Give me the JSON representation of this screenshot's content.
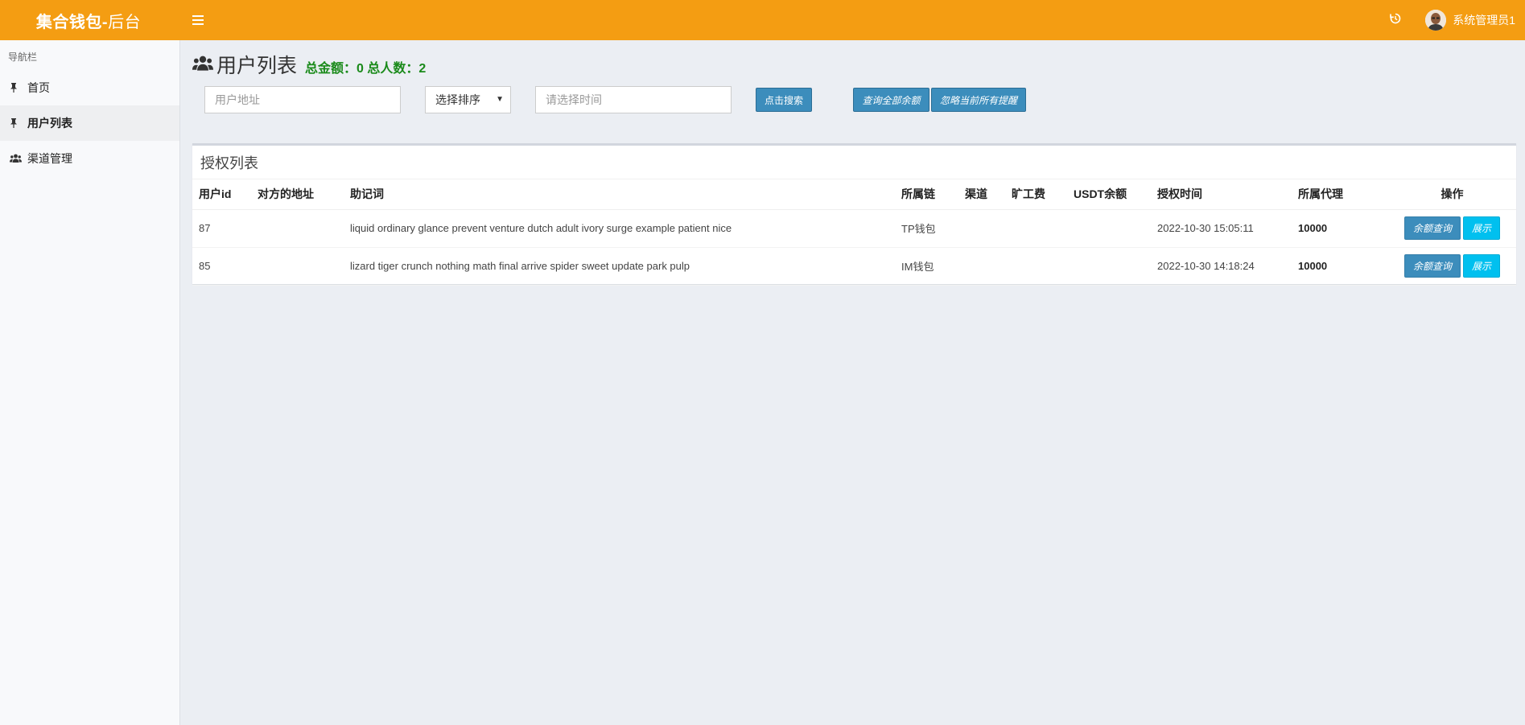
{
  "header": {
    "brand_main": "集合钱包-",
    "brand_suffix": "后台",
    "username": "系统管理员1"
  },
  "sidebar": {
    "caption": "导航栏",
    "items": [
      {
        "label": "首页",
        "icon": "pin-icon"
      },
      {
        "label": "用户列表",
        "icon": "pin-icon",
        "active": true
      },
      {
        "label": "渠道管理",
        "icon": "users-icon"
      }
    ]
  },
  "page": {
    "title": "用户列表",
    "stats": "总金额：0 总人数：2"
  },
  "filters": {
    "address_placeholder": "用户地址",
    "sort_selected": "选择排序",
    "time_placeholder": "请选择时间",
    "search_label": "点击搜索",
    "query_all_label": "查询全部余额",
    "ignore_label": "忽略当前所有提醒"
  },
  "panel": {
    "title": "授权列表",
    "columns": [
      "用户id",
      "对方的地址",
      "助记词",
      "所属链",
      "渠道",
      "旷工费",
      "USDT余额",
      "授权时间",
      "所属代理",
      "操作"
    ],
    "rows": [
      {
        "id": "87",
        "address": "",
        "mnemonic": "liquid ordinary glance prevent venture dutch adult ivory surge example patient nice",
        "chain": "TP钱包",
        "channel": "",
        "fee": "",
        "usdt": "",
        "time": "2022-10-30 15:05:11",
        "agent": "10000",
        "query_label": "余额查询",
        "show_label": "展示"
      },
      {
        "id": "85",
        "address": "",
        "mnemonic": "lizard tiger crunch nothing math final arrive spider sweet update park pulp",
        "chain": "IM钱包",
        "channel": "",
        "fee": "",
        "usdt": "",
        "time": "2022-10-30 14:18:24",
        "agent": "10000",
        "query_label": "余额查询",
        "show_label": "展示"
      }
    ]
  },
  "colors": {
    "header_bg": "#f49d12",
    "stats_green": "#1a8a1a",
    "btn_primary": "#3c8dbc",
    "btn_info": "#00c0ef"
  }
}
